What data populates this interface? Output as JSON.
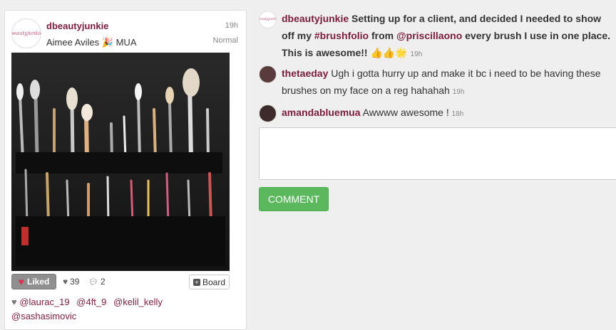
{
  "post": {
    "username": "dbeautyjunkie",
    "fullname": "Aimee Aviles 🎉 MUA",
    "time": "19h",
    "filter": "Normal",
    "liked_label": "Liked",
    "likes_count": "39",
    "comments_count": "2",
    "board_label": "Board",
    "likers": [
      "@laurac_19",
      "@4ft_9",
      "@kelil_kelly",
      "@sashasimovic"
    ],
    "avatar_logo_text": "beautyjunkie"
  },
  "caption": {
    "username": "dbeautyjunkie",
    "text_1": "Setting up for a client, and decided I needed to show off my ",
    "hashtag": "#brushfolio",
    "text_2": " from ",
    "mention": "@priscillaono",
    "text_3": " every brush I use in one place. This is awesome!! ",
    "emojis": "👍👍🌟",
    "time": "19h"
  },
  "comments": [
    {
      "username": "thetaeday",
      "text": "Ugh i gotta hurry up and make it bc i need to be having these brushes on my face on a reg hahahah",
      "time": "19h"
    },
    {
      "username": "amandabluemua",
      "text": "Awwww awesome !",
      "time": "18h"
    }
  ],
  "form": {
    "comment_placeholder": "",
    "submit_label": "COMMENT"
  },
  "colors": {
    "username": "#7a1c3d",
    "comment_button": "#5cb85c",
    "liked_button": "#8f8f8f",
    "heart": "#d9304f"
  }
}
